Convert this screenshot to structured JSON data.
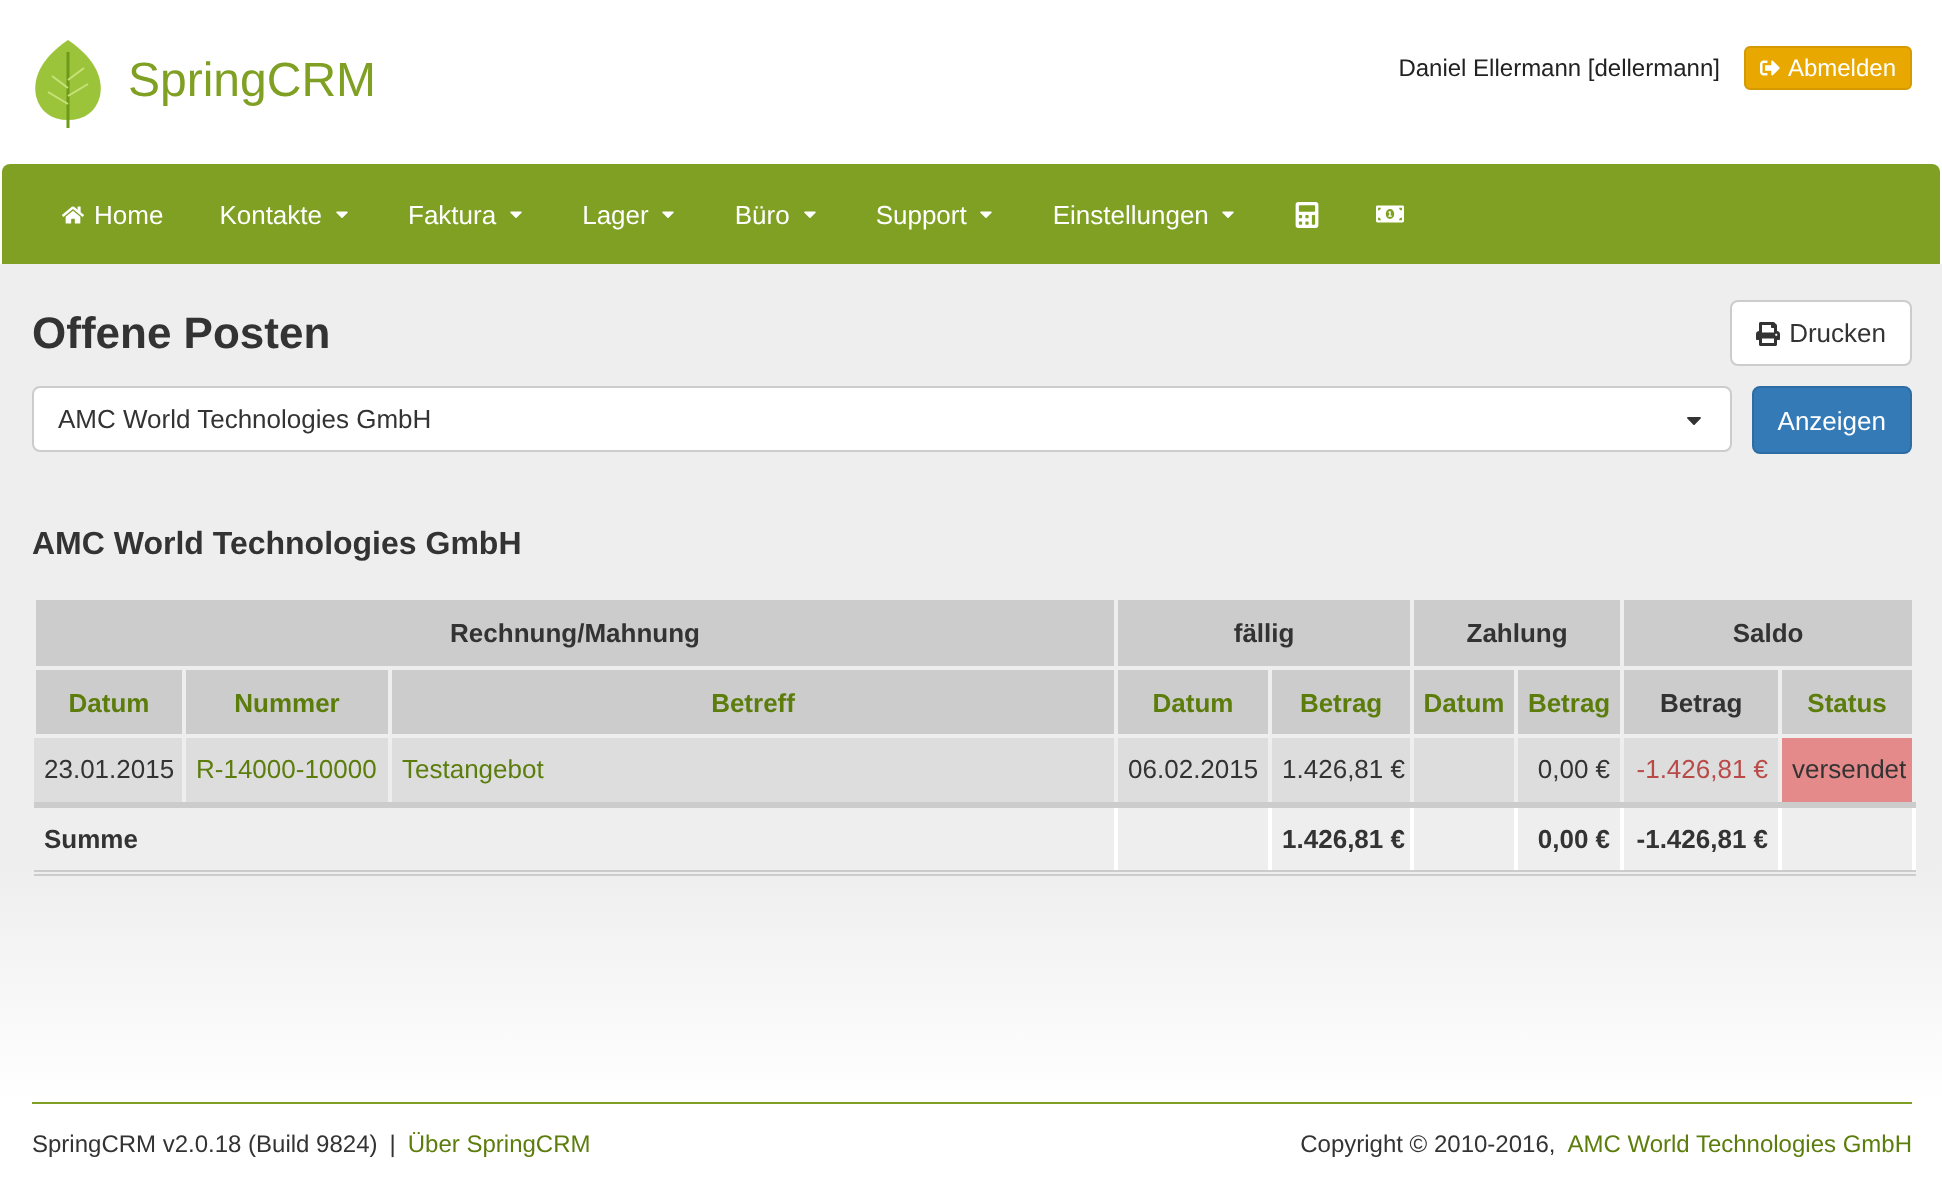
{
  "brand": {
    "name": "SpringCRM"
  },
  "user": {
    "name": "Daniel Ellermann [dellermann]",
    "logout": "Abmelden"
  },
  "nav": [
    {
      "label": "Home",
      "kind": "home"
    },
    {
      "label": "Kontakte",
      "kind": "menu"
    },
    {
      "label": "Faktura",
      "kind": "menu"
    },
    {
      "label": "Lager",
      "kind": "menu"
    },
    {
      "label": "Büro",
      "kind": "menu"
    },
    {
      "label": "Support",
      "kind": "menu"
    },
    {
      "label": "Einstellungen",
      "kind": "menu"
    },
    {
      "kind": "calculator"
    },
    {
      "kind": "money"
    }
  ],
  "page": {
    "title": "Offene Posten",
    "print": "Drucken",
    "select_value": "AMC World Technologies GmbH",
    "show": "Anzeigen",
    "subtitle": "AMC World Technologies GmbH"
  },
  "table": {
    "groups": [
      {
        "label": "Rechnung/Mahnung"
      },
      {
        "label": "fällig"
      },
      {
        "label": "Zahlung"
      },
      {
        "label": "Saldo"
      }
    ],
    "columns": [
      {
        "label": "Datum",
        "sortable": true
      },
      {
        "label": "Nummer",
        "sortable": true
      },
      {
        "label": "Betreff",
        "sortable": true
      },
      {
        "label": "Datum",
        "sortable": true
      },
      {
        "label": "Betrag",
        "sortable": true
      },
      {
        "label": "Datum",
        "sortable": true
      },
      {
        "label": "Betrag",
        "sortable": true
      },
      {
        "label": "Betrag",
        "sortable": false
      },
      {
        "label": "Status",
        "sortable": true
      }
    ],
    "rows": [
      {
        "date": "23.01.2015",
        "number": "R-14000-10000",
        "subject": "Testangebot",
        "due_date": "06.02.2015",
        "due_amount": "1.426,81 €",
        "payment_amount": "0,00 €",
        "balance": "-1.426,81 €",
        "balance_negative": true,
        "status": {
          "text": "versendet",
          "color": "#e58a8a"
        }
      }
    ],
    "total": {
      "label": "Summe",
      "due_amount": "1.426,81 €",
      "payment_amount": "0,00 €",
      "balance": "-1.426,81 €"
    }
  },
  "footer": {
    "version": "SpringCRM v2.0.18 (Build 9824)",
    "separator": "|",
    "about": "Über SpringCRM",
    "copyright": "Copyright © 2010-2016,",
    "company": "AMC World Technologies GmbH"
  }
}
